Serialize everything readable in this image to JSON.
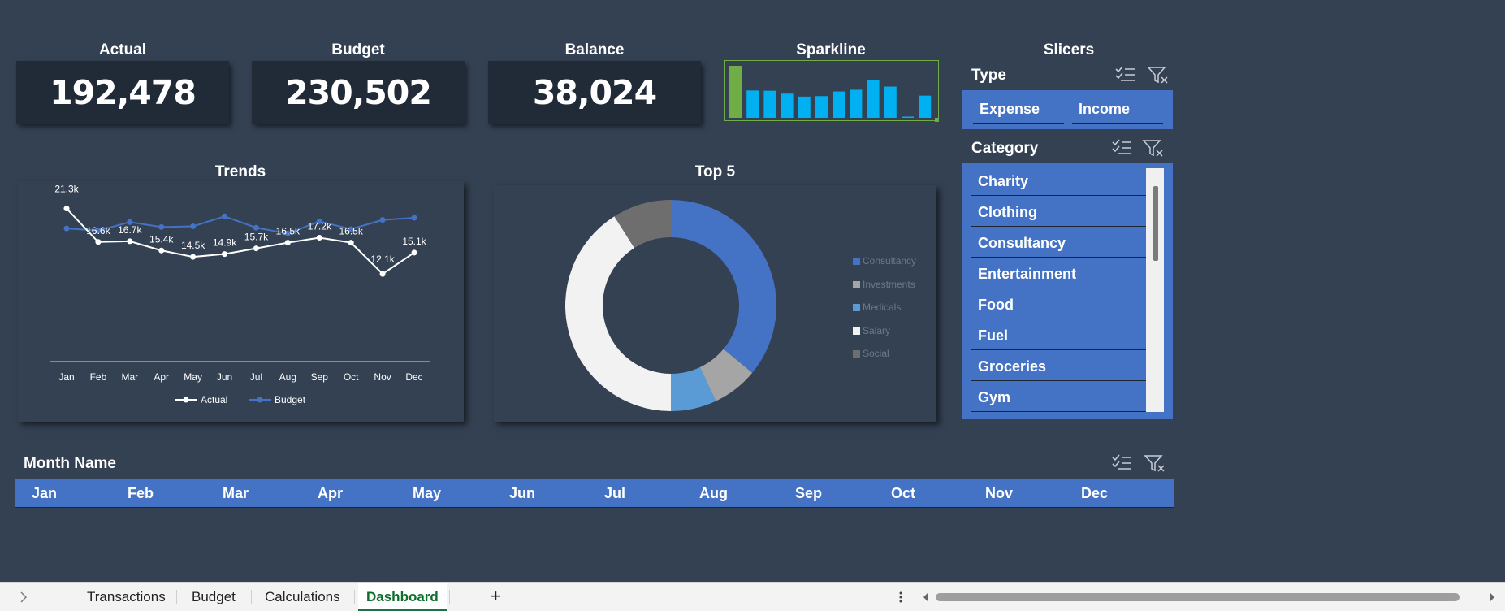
{
  "kpis": [
    {
      "title": "Actual",
      "value": "192,478"
    },
    {
      "title": "Budget",
      "value": "230,502"
    },
    {
      "title": "Balance",
      "value": "38,024"
    }
  ],
  "sparkline": {
    "title": "Sparkline",
    "values": [
      21.3,
      11.2,
      11.1,
      9.9,
      8.7,
      8.9,
      10.8,
      11.5,
      15.4,
      12.8,
      0.5,
      9.1
    ],
    "highlight_color": "#70ad47",
    "bar_color": "#00b0f0"
  },
  "slicers": {
    "title": "Slicers",
    "type": {
      "header": "Type",
      "items": [
        "Expense",
        "Income"
      ]
    },
    "category": {
      "header": "Category",
      "items": [
        "Charity",
        "Clothing",
        "Consultancy",
        "Entertainment",
        "Food",
        "Fuel",
        "Groceries",
        "Gym"
      ]
    },
    "month": {
      "header": "Month Name",
      "items": [
        "Jan",
        "Feb",
        "Mar",
        "Apr",
        "May",
        "Jun",
        "Jul",
        "Aug",
        "Sep",
        "Oct",
        "Nov",
        "Dec"
      ]
    }
  },
  "chart_data": [
    {
      "type": "line",
      "title": "Trends",
      "categories": [
        "Jan",
        "Feb",
        "Mar",
        "Apr",
        "May",
        "Jun",
        "Jul",
        "Aug",
        "Sep",
        "Oct",
        "Nov",
        "Dec"
      ],
      "series": [
        {
          "name": "Actual",
          "color": "#ffffff",
          "values": [
            21.3,
            16.6,
            16.7,
            15.4,
            14.5,
            14.9,
            15.7,
            16.5,
            17.2,
            16.5,
            12.1,
            15.1
          ],
          "labels": [
            "21.3k",
            "16.6k",
            "16.7k",
            "15.4k",
            "14.5k",
            "14.9k",
            "15.7k",
            "16.5k",
            "17.2k",
            "16.5k",
            "12.1k",
            "15.1k"
          ]
        },
        {
          "name": "Budget",
          "color": "#4472c4",
          "values": [
            18.5,
            18.2,
            19.4,
            18.7,
            18.8,
            20.2,
            18.6,
            17.8,
            19.5,
            18.4,
            19.7,
            20.0
          ]
        }
      ],
      "ylim": [
        0,
        24
      ],
      "legend": "bottom"
    },
    {
      "type": "pie",
      "title": "Top 5",
      "labels": [
        "Consultancy",
        "Investments",
        "Medicals",
        "Salary",
        "Social"
      ],
      "values": [
        36,
        7,
        7,
        41,
        9
      ],
      "colors": [
        "#4472c4",
        "#a5a5a5",
        "#5b9bd5",
        "#f2f2f2",
        "#6e6e6e"
      ],
      "legend": "right"
    }
  ],
  "sheet_tabs": [
    "Transactions",
    "Budget",
    "Calculations",
    "Dashboard"
  ],
  "active_tab": "Dashboard",
  "add_sheet": "+",
  "colors": {
    "background": "#344153",
    "slicer": "#4472c4",
    "kpi_box": "#212a37"
  }
}
